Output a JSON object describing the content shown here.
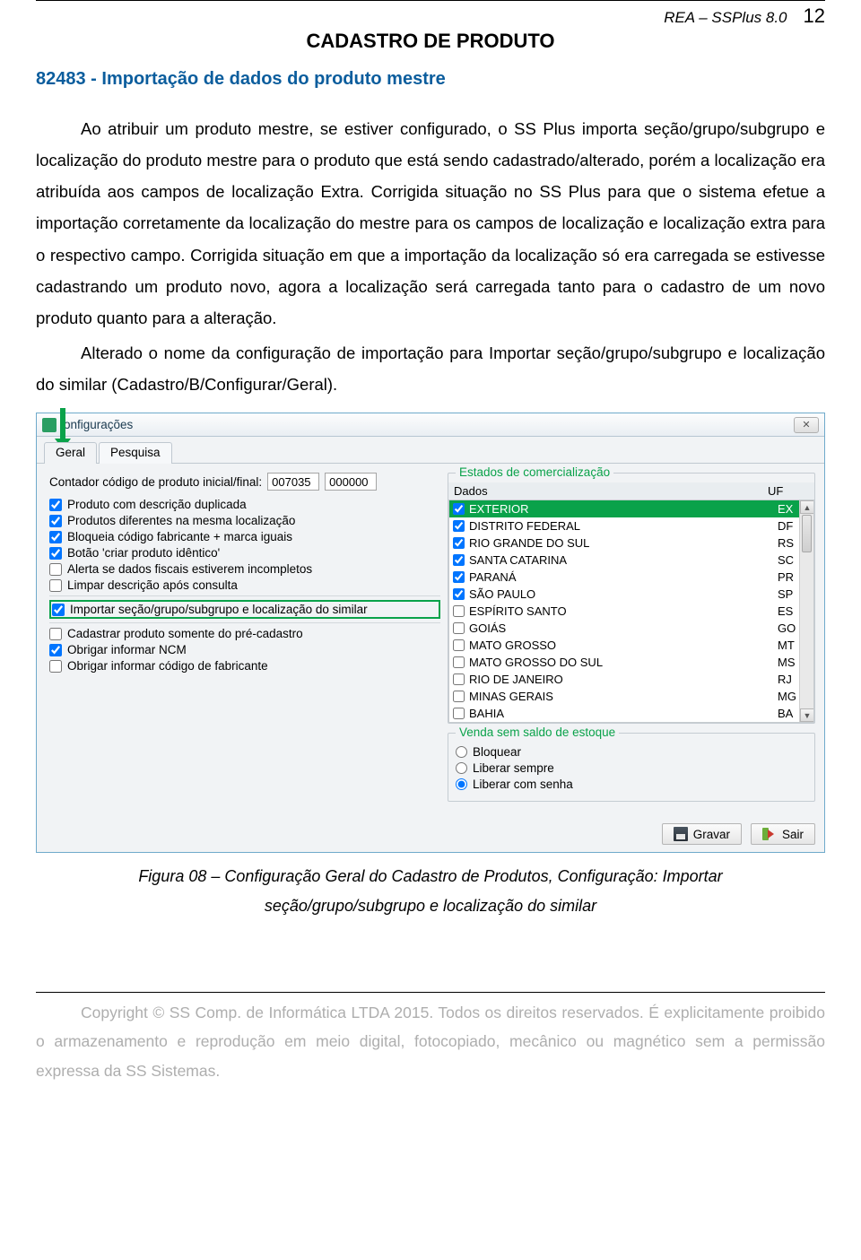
{
  "header": {
    "product": "REA – SSPlus 8.0",
    "page": "12",
    "title": "CADASTRO DE PRODUTO"
  },
  "section": {
    "heading": "82483 - Importação de dados do produto mestre",
    "para1": "Ao atribuir um produto mestre, se estiver configurado, o SS Plus importa seção/grupo/subgrupo e localização do produto mestre para o produto que está sendo cadastrado/alterado, porém a localização era atribuída aos campos de localização Extra. Corrigida situação no SS Plus para que o sistema efetue a importação corretamente da localização do mestre para os campos de localização e localização extra para o respectivo campo. Corrigida situação em que a importação da localização só era carregada se estivesse cadastrando um produto novo, agora a localização será carregada tanto para o cadastro de um novo produto quanto para a alteração.",
    "para2": "Alterado o nome da configuração de importação para Importar seção/grupo/subgrupo e localização do similar (Cadastro/B/Configurar/Geral)."
  },
  "window": {
    "title": "onfigurações",
    "tabs": [
      "Geral",
      "Pesquisa"
    ],
    "actions": {
      "save": "Gravar",
      "exit": "Sair"
    }
  },
  "left": {
    "counter_label": "Contador código de produto inicial/final:",
    "counter_initial": "007035",
    "counter_final": "000000",
    "checks": [
      {
        "label": "Produto com descrição duplicada",
        "checked": true,
        "hl": false
      },
      {
        "label": "Produtos diferentes na mesma localização",
        "checked": true,
        "hl": false
      },
      {
        "label": "Bloqueia código fabricante + marca iguais",
        "checked": true,
        "hl": false
      },
      {
        "label": "Botão 'criar produto idêntico'",
        "checked": true,
        "hl": false
      },
      {
        "label": "Alerta se dados fiscais estiverem incompletos",
        "checked": false,
        "hl": false
      },
      {
        "label": "Limpar descrição após consulta",
        "checked": false,
        "hl": false
      },
      {
        "label": "Importar seção/grupo/subgrupo e localização do similar",
        "checked": true,
        "hl": true
      },
      {
        "label": "Cadastrar produto somente do pré-cadastro",
        "checked": false,
        "hl": false
      },
      {
        "label": "Obrigar informar NCM",
        "checked": true,
        "hl": false
      },
      {
        "label": "Obrigar informar código de fabricante",
        "checked": false,
        "hl": false
      }
    ]
  },
  "right": {
    "estados": {
      "caption": "Estados de comercialização",
      "col1": "Dados",
      "col2": "UF",
      "rows": [
        {
          "name": "EXTERIOR",
          "uf": "EX",
          "checked": true,
          "selected": true
        },
        {
          "name": "DISTRITO FEDERAL",
          "uf": "DF",
          "checked": true,
          "selected": false
        },
        {
          "name": "RIO GRANDE DO SUL",
          "uf": "RS",
          "checked": true,
          "selected": false
        },
        {
          "name": "SANTA CATARINA",
          "uf": "SC",
          "checked": true,
          "selected": false
        },
        {
          "name": "PARANÁ",
          "uf": "PR",
          "checked": true,
          "selected": false
        },
        {
          "name": "SÃO PAULO",
          "uf": "SP",
          "checked": true,
          "selected": false
        },
        {
          "name": "ESPÍRITO SANTO",
          "uf": "ES",
          "checked": false,
          "selected": false
        },
        {
          "name": "GOIÁS",
          "uf": "GO",
          "checked": false,
          "selected": false
        },
        {
          "name": "MATO GROSSO",
          "uf": "MT",
          "checked": false,
          "selected": false
        },
        {
          "name": "MATO GROSSO DO SUL",
          "uf": "MS",
          "checked": false,
          "selected": false
        },
        {
          "name": "RIO DE JANEIRO",
          "uf": "RJ",
          "checked": false,
          "selected": false
        },
        {
          "name": "MINAS GERAIS",
          "uf": "MG",
          "checked": false,
          "selected": false
        },
        {
          "name": "BAHIA",
          "uf": "BA",
          "checked": false,
          "selected": false
        }
      ]
    },
    "venda": {
      "caption": "Venda sem saldo de estoque",
      "options": [
        {
          "label": "Bloquear",
          "selected": false
        },
        {
          "label": "Liberar sempre",
          "selected": false
        },
        {
          "label": "Liberar com senha",
          "selected": true
        }
      ]
    }
  },
  "figure": {
    "line1": "Figura 08 – Configuração Geral do Cadastro de Produtos, Configuração: Importar",
    "line2": "seção/grupo/subgrupo e localização do similar"
  },
  "footer": {
    "text": "Copyright © SS Comp. de Informática LTDA 2015. Todos os direitos reservados. É explicitamente proibido o armazenamento e reprodução em meio digital, fotocopiado, mecânico ou magnético sem a permissão expressa da SS Sistemas."
  }
}
